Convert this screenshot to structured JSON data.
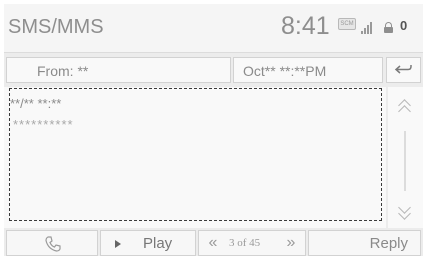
{
  "status_bar": {
    "app_title": "SMS/MMS",
    "clock": "8:41",
    "badge_text": "SCM",
    "unread_count": "0",
    "icons": [
      "message-badge-icon",
      "signal-icon",
      "lock-icon"
    ]
  },
  "message": {
    "from_label": "From: **",
    "date_label": "Oct** **:**PM",
    "sent_time": "**/** **:**",
    "body": "**********"
  },
  "controls": {
    "call_icon": "phone-icon",
    "play_label": "Play",
    "prev_label": "«",
    "page_label": "3 of 45",
    "next_label": "»",
    "reply_label": "Reply"
  },
  "colors": {
    "background": "#ececec",
    "panel": "#f9f9f9",
    "text_gray": "#8a8a8a"
  }
}
